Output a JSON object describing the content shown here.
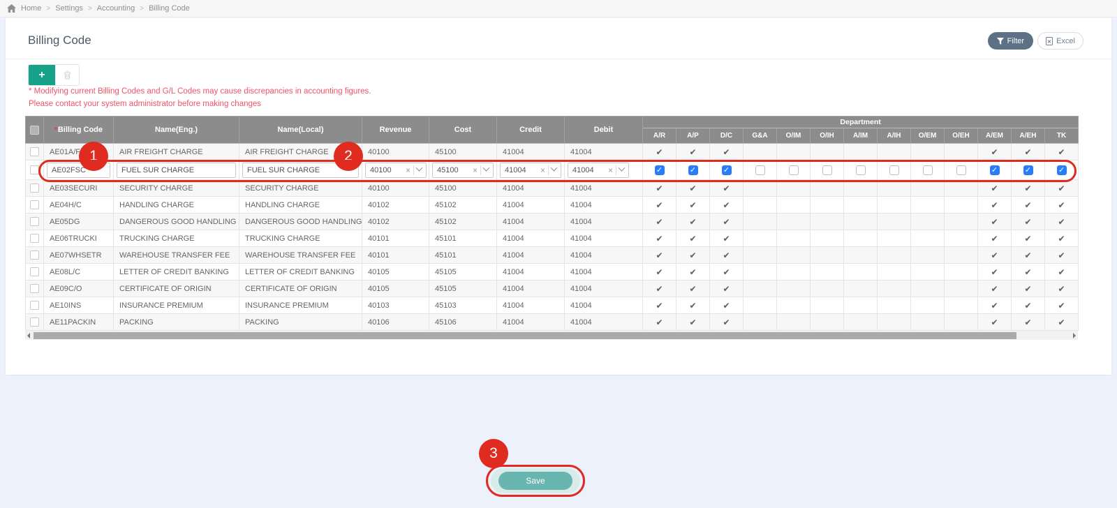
{
  "breadcrumb": {
    "items": [
      "Home",
      "Settings",
      "Accounting",
      "Billing Code"
    ],
    "separator": ">"
  },
  "page": {
    "title": "Billing Code"
  },
  "top_actions": {
    "filter_label": "Filter",
    "excel_label": "Excel"
  },
  "warning": {
    "line1": "* Modifying current Billing Codes and G/L Codes may cause discrepancies in accounting figures.",
    "line2": "Please contact your system administrator before making changes"
  },
  "table": {
    "required_marker": "*",
    "columns": {
      "billing_code": "Billing Code",
      "name_eng": "Name(Eng.)",
      "name_local": "Name(Local)",
      "revenue": "Revenue",
      "cost": "Cost",
      "credit": "Credit",
      "debit": "Debit"
    },
    "department_group_label": "Department",
    "department_columns": [
      "A/R",
      "A/P",
      "D/C",
      "G&A",
      "O/IM",
      "O/IH",
      "A/IM",
      "A/IH",
      "O/EM",
      "O/EH",
      "A/EM",
      "A/EH",
      "TK"
    ],
    "rows": [
      {
        "code": "AE01A/F",
        "name_eng": "AIR FREIGHT CHARGE",
        "name_local": "AIR FREIGHT CHARGE",
        "revenue": "40100",
        "cost": "45100",
        "credit": "41004",
        "debit": "41004",
        "editing": false,
        "departments": [
          1,
          1,
          1,
          0,
          0,
          0,
          0,
          0,
          0,
          0,
          1,
          1,
          1
        ]
      },
      {
        "code": "AE02FSC",
        "name_eng": "FUEL SUR CHARGE",
        "name_local": "FUEL SUR CHARGE",
        "revenue": "40100",
        "cost": "45100",
        "credit": "41004",
        "debit": "41004",
        "editing": true,
        "departments": [
          1,
          1,
          1,
          0,
          0,
          0,
          0,
          0,
          0,
          0,
          1,
          1,
          1
        ]
      },
      {
        "code": "AE03SECURI",
        "name_eng": "SECURITY CHARGE",
        "name_local": "SECURITY CHARGE",
        "revenue": "40100",
        "cost": "45100",
        "credit": "41004",
        "debit": "41004",
        "editing": false,
        "departments": [
          1,
          1,
          1,
          0,
          0,
          0,
          0,
          0,
          0,
          0,
          1,
          1,
          1
        ]
      },
      {
        "code": "AE04H/C",
        "name_eng": "HANDLING CHARGE",
        "name_local": "HANDLING CHARGE",
        "revenue": "40102",
        "cost": "45102",
        "credit": "41004",
        "debit": "41004",
        "editing": false,
        "departments": [
          1,
          1,
          1,
          0,
          0,
          0,
          0,
          0,
          0,
          0,
          1,
          1,
          1
        ]
      },
      {
        "code": "AE05DG",
        "name_eng": "DANGEROUS GOOD HANDLING",
        "name_local": "DANGEROUS GOOD HANDLING",
        "revenue": "40102",
        "cost": "45102",
        "credit": "41004",
        "debit": "41004",
        "editing": false,
        "departments": [
          1,
          1,
          1,
          0,
          0,
          0,
          0,
          0,
          0,
          0,
          1,
          1,
          1
        ]
      },
      {
        "code": "AE06TRUCKI",
        "name_eng": "TRUCKING CHARGE",
        "name_local": "TRUCKING CHARGE",
        "revenue": "40101",
        "cost": "45101",
        "credit": "41004",
        "debit": "41004",
        "editing": false,
        "departments": [
          1,
          1,
          1,
          0,
          0,
          0,
          0,
          0,
          0,
          0,
          1,
          1,
          1
        ]
      },
      {
        "code": "AE07WHSETR",
        "name_eng": "WAREHOUSE TRANSFER FEE",
        "name_local": "WAREHOUSE TRANSFER FEE",
        "revenue": "40101",
        "cost": "45101",
        "credit": "41004",
        "debit": "41004",
        "editing": false,
        "departments": [
          1,
          1,
          1,
          0,
          0,
          0,
          0,
          0,
          0,
          0,
          1,
          1,
          1
        ]
      },
      {
        "code": "AE08L/C",
        "name_eng": "LETTER OF CREDIT BANKING",
        "name_local": "LETTER OF CREDIT BANKING",
        "revenue": "40105",
        "cost": "45105",
        "credit": "41004",
        "debit": "41004",
        "editing": false,
        "departments": [
          1,
          1,
          1,
          0,
          0,
          0,
          0,
          0,
          0,
          0,
          1,
          1,
          1
        ]
      },
      {
        "code": "AE09C/O",
        "name_eng": "CERTIFICATE OF ORIGIN",
        "name_local": "CERTIFICATE OF ORIGIN",
        "revenue": "40105",
        "cost": "45105",
        "credit": "41004",
        "debit": "41004",
        "editing": false,
        "departments": [
          1,
          1,
          1,
          0,
          0,
          0,
          0,
          0,
          0,
          0,
          1,
          1,
          1
        ]
      },
      {
        "code": "AE10INS",
        "name_eng": "INSURANCE PREMIUM",
        "name_local": "INSURANCE PREMIUM",
        "revenue": "40103",
        "cost": "45103",
        "credit": "41004",
        "debit": "41004",
        "editing": false,
        "departments": [
          1,
          1,
          1,
          0,
          0,
          0,
          0,
          0,
          0,
          0,
          1,
          1,
          1
        ]
      },
      {
        "code": "AE11PACKIN",
        "name_eng": "PACKING",
        "name_local": "PACKING",
        "revenue": "40106",
        "cost": "45106",
        "credit": "41004",
        "debit": "41004",
        "editing": false,
        "departments": [
          1,
          1,
          1,
          0,
          0,
          0,
          0,
          0,
          0,
          0,
          1,
          1,
          1
        ]
      }
    ]
  },
  "annotations": {
    "step1": "1",
    "step2": "2",
    "step3": "3"
  },
  "save_button": {
    "label": "Save"
  },
  "icons": {
    "check": "✔",
    "clear": "×",
    "check_white": "✓"
  },
  "colors": {
    "accent_teal": "#16a189",
    "save_teal": "#69b6b1",
    "annotation_red": "#e02b20",
    "warning_red": "#ef5365",
    "checked_blue": "#2b7cf7",
    "header_gray": "#8c8c8c",
    "filter_slate": "#5d7186",
    "page_bg": "#edf1fb"
  }
}
